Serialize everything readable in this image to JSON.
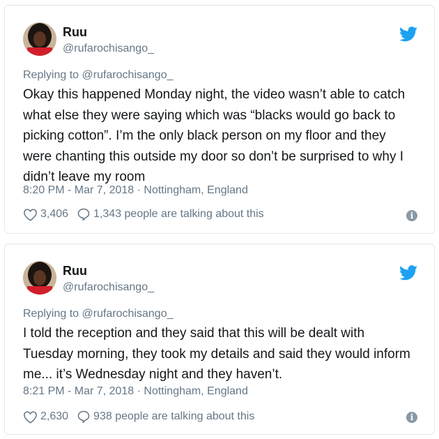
{
  "colors": {
    "twitter_blue": "#1da1f2",
    "muted": "#657786",
    "text": "#14171a",
    "border": "#e1e8ed"
  },
  "tweets": [
    {
      "name": "Ruu",
      "handle": "@rufarochisango_",
      "reply_prefix": "Replying to",
      "reply_to": "@rufarochisango_",
      "text": "Okay this happened Monday night, the video wasn’t able to catch what else they were saying which was “blacks would go back to picking cotton”. I’m the only black person on my floor and they were chanting this outside my door so don’t be surprised to why I didn’t leave my room",
      "timestamp": "8:20 PM - Mar 7, 2018 · Nottingham, England",
      "likes": "3,406",
      "talking": "1,343 people are talking about this",
      "icons": {
        "like": "heart-icon",
        "reply": "comment-icon",
        "info": "info-icon",
        "brand": "twitter-bird-icon"
      }
    },
    {
      "name": "Ruu",
      "handle": "@rufarochisango_",
      "reply_prefix": "Replying to",
      "reply_to": "@rufarochisango_",
      "text": "I told the reception and they said that this will be dealt with Tuesday morning, they took my details and said they would inform me... it’s Wednesday night and they haven’t.",
      "timestamp": "8:21 PM - Mar 7, 2018 · Nottingham, England",
      "likes": "2,630",
      "talking": "938 people are talking about this",
      "icons": {
        "like": "heart-icon",
        "reply": "comment-icon",
        "info": "info-icon",
        "brand": "twitter-bird-icon"
      }
    }
  ]
}
